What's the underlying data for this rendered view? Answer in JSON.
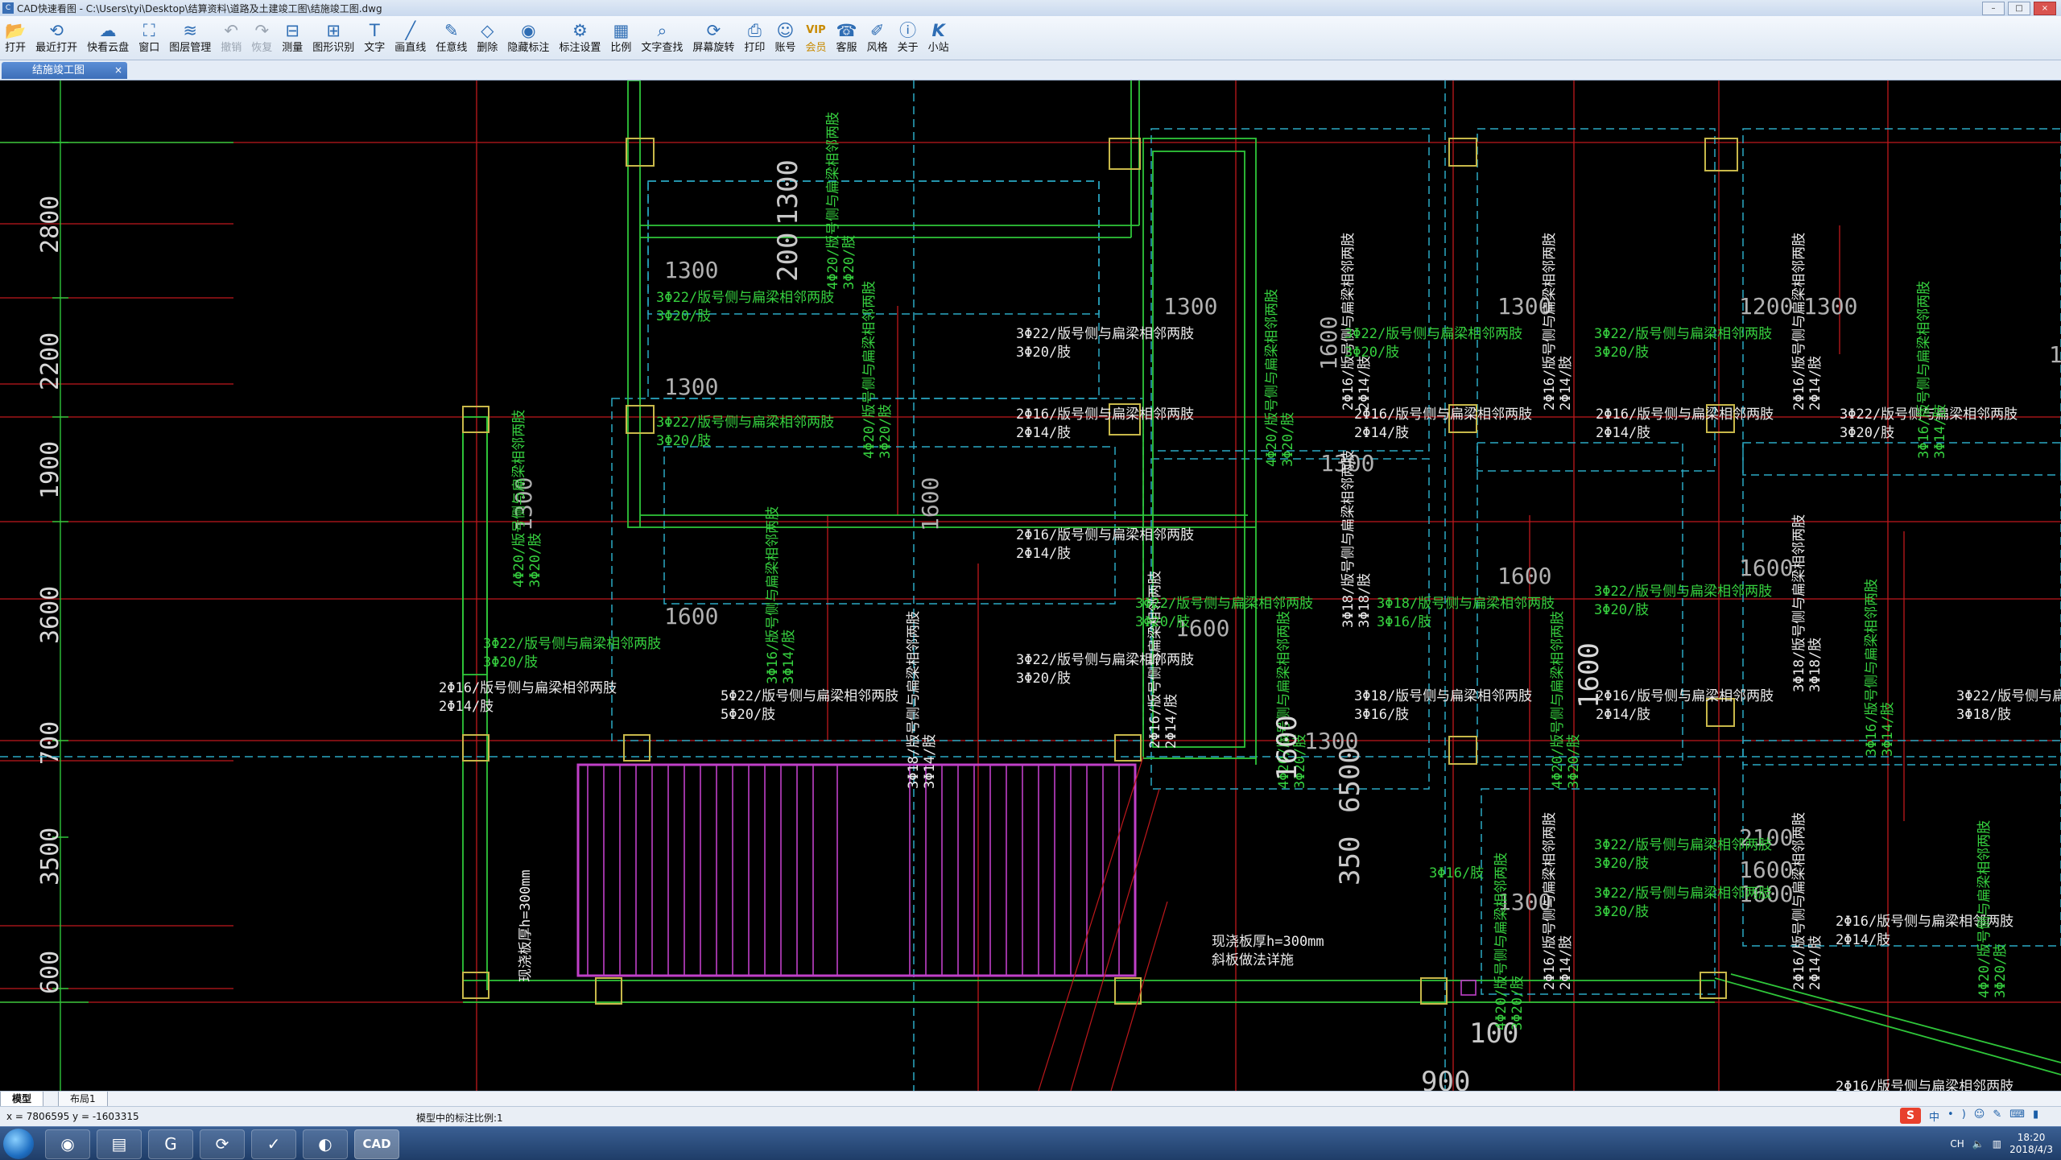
{
  "window": {
    "title": "CAD快速看图 - C:\\Users\\tyi\\Desktop\\结算资料\\道路及土建竣工图\\结施竣工图.dwg",
    "controls": {
      "min": "–",
      "max": "□",
      "close": "×"
    }
  },
  "toolbar": {
    "items": [
      {
        "label": "打开",
        "icon": "📂"
      },
      {
        "label": "最近打开",
        "icon": "⟲"
      },
      {
        "label": "快看云盘",
        "icon": "☁"
      },
      {
        "label": "窗口",
        "icon": "⛶"
      },
      {
        "label": "图层管理",
        "icon": "≋"
      },
      {
        "label": "撤销",
        "icon": "↶"
      },
      {
        "label": "恢复",
        "icon": "↷"
      },
      {
        "label": "测量",
        "icon": "⊟"
      },
      {
        "label": "图形识别",
        "icon": "⊞"
      },
      {
        "label": "文字",
        "icon": "T"
      },
      {
        "label": "画直线",
        "icon": "╱"
      },
      {
        "label": "任意线",
        "icon": "✎"
      },
      {
        "label": "删除",
        "icon": "◇"
      },
      {
        "label": "隐藏标注",
        "icon": "◉"
      },
      {
        "label": "标注设置",
        "icon": "⚙"
      },
      {
        "label": "比例",
        "icon": "▦"
      },
      {
        "label": "文字查找",
        "icon": "⌕"
      },
      {
        "label": "屏幕旋转",
        "icon": "⟳"
      },
      {
        "label": "打印",
        "icon": "⎙"
      },
      {
        "label": "账号",
        "icon": "☺"
      },
      {
        "label": "会员",
        "icon": "VIP"
      },
      {
        "label": "客服",
        "icon": "☎"
      },
      {
        "label": "风格",
        "icon": "✐"
      },
      {
        "label": "关于",
        "icon": "ⓘ"
      },
      {
        "label": "小站",
        "icon": "K"
      }
    ]
  },
  "tabs": {
    "active_doc": "结施竣工图",
    "close": "×"
  },
  "drawing": {
    "dims_left": [
      "2800",
      "2200",
      "1900",
      "3600",
      "700",
      "3500",
      "600"
    ],
    "dims_inner": [
      "1300",
      "1300",
      "1300",
      "1600",
      "1300",
      "1300",
      "1300",
      "1300",
      "1600",
      "1600",
      "1200",
      "1300",
      "2100",
      "1600",
      "1600",
      "1300",
      "1600",
      "1600"
    ],
    "dim_200": "200",
    "dim_6500": "6500",
    "dim_350": "350",
    "dim_100": "100",
    "dim_900": "900",
    "anno_3c22": "3Φ22/版号侧与扁梁相邻两肢",
    "anno_3c20": "3Φ20/肢",
    "anno_2c16": "2Φ16/版号侧与扁梁相邻两肢",
    "anno_2c14": "2Φ14/肢",
    "anno_5c22": "5Φ22/版号侧与扁梁相邻两肢",
    "anno_5c20": "5Φ20/肢",
    "anno_3c18": "3Φ18/版号侧与扁梁相邻两肢",
    "anno_3c16": "3Φ16/肢",
    "anno_3c18b": "3Φ18/肢",
    "anno_v1": "4Φ20/版号侧与扁梁相邻两肢",
    "anno_v2": "3Φ20/肢",
    "anno_v3": "3Φ16/版号侧与扁梁相邻两肢",
    "anno_v4": "3Φ14/肢",
    "anno_v5": "3Φ18/版号侧与扁梁相邻两肢",
    "anno_v6": "2Φ16/版号侧与扁梁相邻两肢",
    "anno_v7": "2Φ14/肢",
    "slab_note_1": "现浇板厚h=300mm",
    "slab_note_2": "斜板做法详施",
    "slab_note_left": "现浇板厚h=300mm"
  },
  "layout_tabs": [
    "模型",
    "布局1"
  ],
  "status": {
    "coords": "x = 7806595  y = -1603315",
    "scale": "模型中的标注比例:1"
  },
  "system": {
    "tray_items": [
      "CH",
      "S",
      "中",
      "•",
      ")",
      "☺",
      "✎",
      "⌨",
      "▮"
    ],
    "time": "18:20",
    "date": "2018/4/3"
  }
}
